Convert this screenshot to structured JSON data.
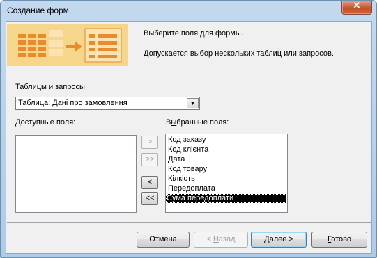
{
  "window": {
    "title": "Создание форм",
    "close_glyph": "✕"
  },
  "banner": {
    "line1": "Выберите поля для формы.",
    "line2": "Допускается выбор нескольких таблиц или запросов.",
    "colors": {
      "bg": "#f5d68a",
      "accent": "#e98a2c",
      "card": "#fbe3b3"
    }
  },
  "tables": {
    "label_prefix": "",
    "label_hotkey": "Т",
    "label_rest": "аблицы и запросы",
    "selected": "Таблица: Дані про замовлення",
    "arrow_icon": "▼"
  },
  "available": {
    "label_hotkey": "Д",
    "label_rest": "оступные поля:",
    "items": []
  },
  "selected_fields": {
    "label_prefix": "В",
    "label_hotkey": "ы",
    "label_rest": "бранные поля:",
    "items": [
      "Код заказу",
      "Код клієнта",
      "Дата",
      "Код товару",
      "Кілкість",
      "Передоплата",
      "Сума передоплати"
    ],
    "selected_index": 6
  },
  "move_buttons": {
    "add_one": ">",
    "add_all": ">>",
    "remove_one": "<",
    "remove_all": "<<"
  },
  "buttons": {
    "cancel": "Отмена",
    "back_prefix": "< ",
    "back_hotkey": "Н",
    "back_rest": "азад",
    "next_hotkey": "Д",
    "next_rest": "алее >",
    "finish_hotkey": "Г",
    "finish_rest": "отово"
  }
}
